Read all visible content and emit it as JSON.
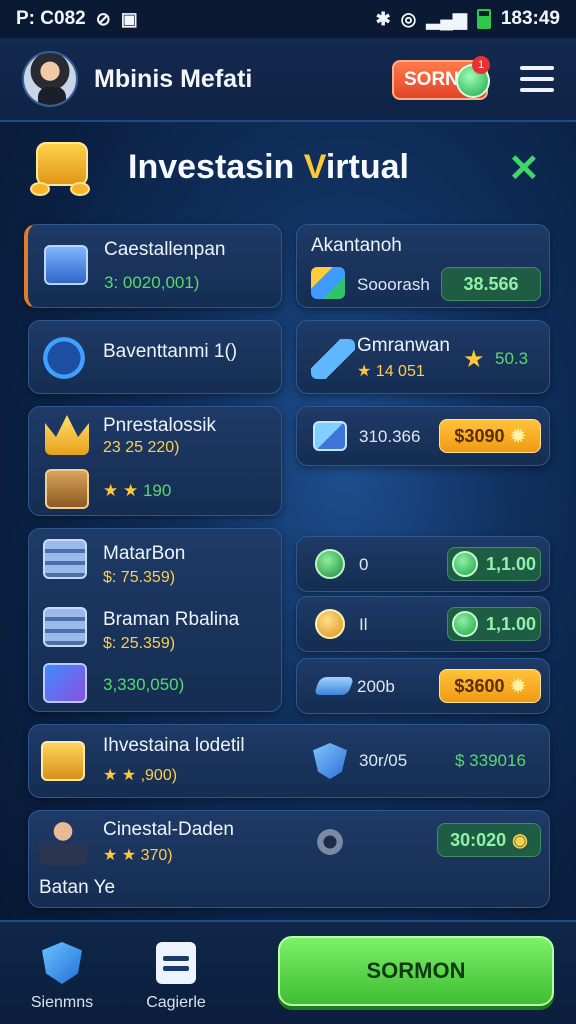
{
  "status": {
    "left_text": "P: C082",
    "time": "183:49"
  },
  "header": {
    "username": "Mbinis Mefati",
    "sorn_label": "SORN",
    "notif": "1"
  },
  "title": {
    "main": "Investasin ",
    "highlight": "V",
    "rest": "irtual"
  },
  "cards": {
    "c1": {
      "title": "Caestallenpan",
      "value": "3: 0020,001)"
    },
    "c2": {
      "title": "Akantanoh",
      "sub": "Sooorash",
      "pill": "38.566"
    },
    "c3": {
      "title": "Baventtanmi 1()"
    },
    "c4": {
      "title": "Gmranwan",
      "sub": "14 051",
      "value": "50.3"
    },
    "c5": {
      "title": "Pnrestalossik",
      "value": "23 25 220)",
      "sub": "190"
    },
    "c6": {
      "value": "310.366",
      "pill": "$3090"
    },
    "c7": {
      "title": "MatarBon",
      "value": "$: 75.359)",
      "title2": "Braman Rbalina",
      "value2": "$: 25.359)",
      "value3": "3,330,050)"
    },
    "c8": {
      "value": "0",
      "pill": "1,1.00"
    },
    "c9": {
      "value": "Il",
      "pill": "1,1.00"
    },
    "c10": {
      "value": "200b",
      "pill": "$3600"
    },
    "c11": {
      "title": "Ihvestaina lodetil",
      "sub": ",900)",
      "mid": "30r/05",
      "value": "$ 339016"
    },
    "c12": {
      "title": "Cinestal-Daden",
      "sub": "370)",
      "pill": "30:020",
      "footer": "Batan Ye"
    }
  },
  "bottom": {
    "nav1": "Sienmns",
    "nav2": "Cagierle",
    "main_button": "SORMON"
  },
  "colors": {
    "accent_gold": "#ffc83a",
    "accent_green": "#3fbd32",
    "background": "#0a1f40"
  }
}
